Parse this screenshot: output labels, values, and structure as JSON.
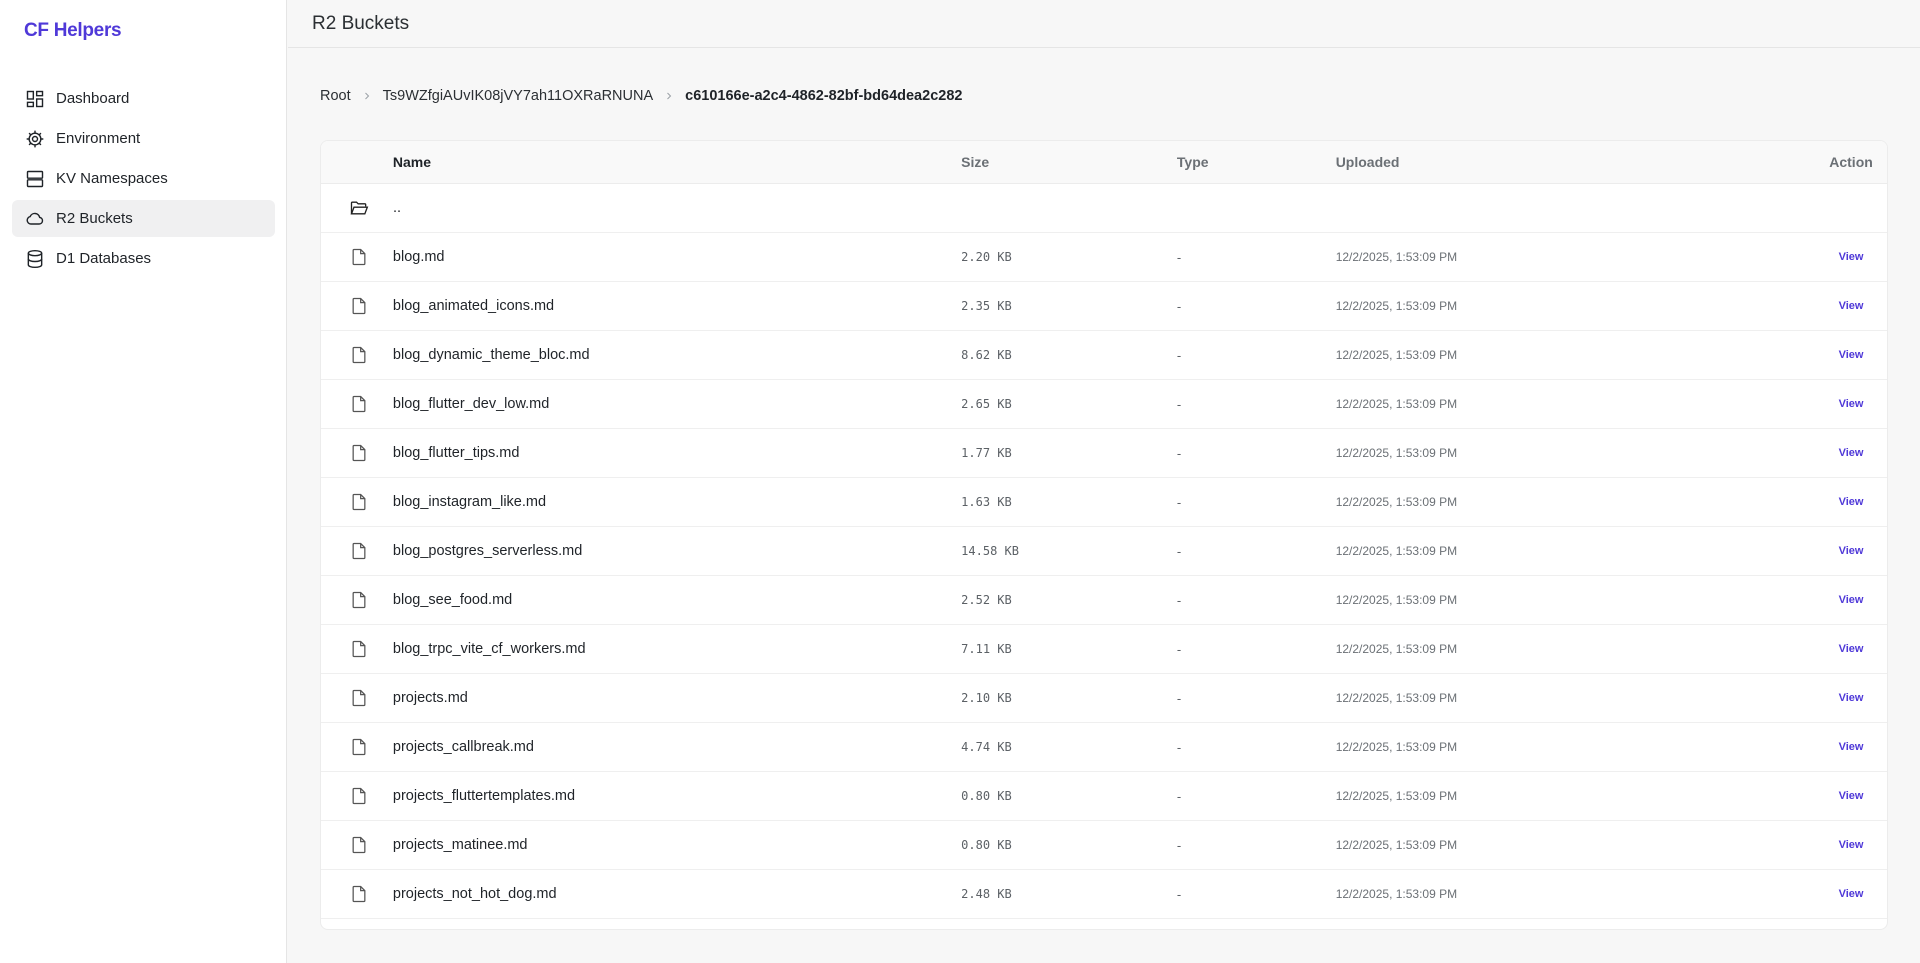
{
  "sidebar": {
    "brand": "CF Helpers",
    "items": [
      {
        "label": "Dashboard",
        "icon": "dashboard-icon",
        "active": false
      },
      {
        "label": "Environment",
        "icon": "gear-icon",
        "active": false
      },
      {
        "label": "KV Namespaces",
        "icon": "server-icon",
        "active": false
      },
      {
        "label": "R2 Buckets",
        "icon": "cloud-icon",
        "active": true
      },
      {
        "label": "D1 Databases",
        "icon": "database-icon",
        "active": false
      }
    ]
  },
  "header": {
    "title": "R2 Buckets"
  },
  "breadcrumb": {
    "root": "Root",
    "bucket": "Ts9WZfgiAUvIK08jVY7ah11OXRaRNUNA",
    "current": "c610166e-a2c4-4862-82bf-bd64dea2c282"
  },
  "table": {
    "headers": {
      "name": "Name",
      "size": "Size",
      "type": "Type",
      "uploaded": "Uploaded",
      "action": "Action"
    },
    "parent": {
      "name": "..",
      "icon": "folder-open-icon"
    },
    "rows": [
      {
        "name": "blog.md",
        "size": "2.20 KB",
        "type": "-",
        "uploaded": "12/2/2025, 1:53:09 PM",
        "action": "View"
      },
      {
        "name": "blog_animated_icons.md",
        "size": "2.35 KB",
        "type": "-",
        "uploaded": "12/2/2025, 1:53:09 PM",
        "action": "View"
      },
      {
        "name": "blog_dynamic_theme_bloc.md",
        "size": "8.62 KB",
        "type": "-",
        "uploaded": "12/2/2025, 1:53:09 PM",
        "action": "View"
      },
      {
        "name": "blog_flutter_dev_low.md",
        "size": "2.65 KB",
        "type": "-",
        "uploaded": "12/2/2025, 1:53:09 PM",
        "action": "View"
      },
      {
        "name": "blog_flutter_tips.md",
        "size": "1.77 KB",
        "type": "-",
        "uploaded": "12/2/2025, 1:53:09 PM",
        "action": "View"
      },
      {
        "name": "blog_instagram_like.md",
        "size": "1.63 KB",
        "type": "-",
        "uploaded": "12/2/2025, 1:53:09 PM",
        "action": "View"
      },
      {
        "name": "blog_postgres_serverless.md",
        "size": "14.58 KB",
        "type": "-",
        "uploaded": "12/2/2025, 1:53:09 PM",
        "action": "View"
      },
      {
        "name": "blog_see_food.md",
        "size": "2.52 KB",
        "type": "-",
        "uploaded": "12/2/2025, 1:53:09 PM",
        "action": "View"
      },
      {
        "name": "blog_trpc_vite_cf_workers.md",
        "size": "7.11 KB",
        "type": "-",
        "uploaded": "12/2/2025, 1:53:09 PM",
        "action": "View"
      },
      {
        "name": "projects.md",
        "size": "2.10 KB",
        "type": "-",
        "uploaded": "12/2/2025, 1:53:09 PM",
        "action": "View"
      },
      {
        "name": "projects_callbreak.md",
        "size": "4.74 KB",
        "type": "-",
        "uploaded": "12/2/2025, 1:53:09 PM",
        "action": "View"
      },
      {
        "name": "projects_fluttertemplates.md",
        "size": "0.80 KB",
        "type": "-",
        "uploaded": "12/2/2025, 1:53:09 PM",
        "action": "View"
      },
      {
        "name": "projects_matinee.md",
        "size": "0.80 KB",
        "type": "-",
        "uploaded": "12/2/2025, 1:53:09 PM",
        "action": "View"
      },
      {
        "name": "projects_not_hot_dog.md",
        "size": "2.48 KB",
        "type": "-",
        "uploaded": "12/2/2025, 1:53:09 PM",
        "action": "View"
      }
    ]
  },
  "colors": {
    "accent": "#4f39d8",
    "active_bg": "#f0f0f1"
  }
}
